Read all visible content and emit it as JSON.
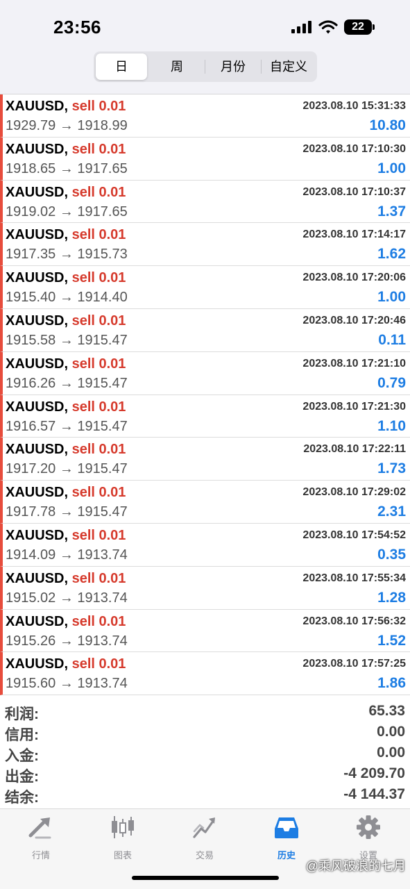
{
  "status_bar": {
    "time": "23:56",
    "battery": "22"
  },
  "segments": [
    {
      "label": "日",
      "active": true
    },
    {
      "label": "周",
      "active": false
    },
    {
      "label": "月份",
      "active": false
    },
    {
      "label": "自定义",
      "active": false
    }
  ],
  "trades": [
    {
      "symbol": "XAUUSD,",
      "side": "sell 0.01",
      "time": "2023.08.10 15:31:33",
      "prices": "1929.79 → 1918.99",
      "profit": "10.80"
    },
    {
      "symbol": "XAUUSD,",
      "side": "sell 0.01",
      "time": "2023.08.10 17:10:30",
      "prices": "1918.65 → 1917.65",
      "profit": "1.00"
    },
    {
      "symbol": "XAUUSD,",
      "side": "sell 0.01",
      "time": "2023.08.10 17:10:37",
      "prices": "1919.02 → 1917.65",
      "profit": "1.37"
    },
    {
      "symbol": "XAUUSD,",
      "side": "sell 0.01",
      "time": "2023.08.10 17:14:17",
      "prices": "1917.35 → 1915.73",
      "profit": "1.62"
    },
    {
      "symbol": "XAUUSD,",
      "side": "sell 0.01",
      "time": "2023.08.10 17:20:06",
      "prices": "1915.40 → 1914.40",
      "profit": "1.00"
    },
    {
      "symbol": "XAUUSD,",
      "side": "sell 0.01",
      "time": "2023.08.10 17:20:46",
      "prices": "1915.58 → 1915.47",
      "profit": "0.11"
    },
    {
      "symbol": "XAUUSD,",
      "side": "sell 0.01",
      "time": "2023.08.10 17:21:10",
      "prices": "1916.26 → 1915.47",
      "profit": "0.79"
    },
    {
      "symbol": "XAUUSD,",
      "side": "sell 0.01",
      "time": "2023.08.10 17:21:30",
      "prices": "1916.57 → 1915.47",
      "profit": "1.10"
    },
    {
      "symbol": "XAUUSD,",
      "side": "sell 0.01",
      "time": "2023.08.10 17:22:11",
      "prices": "1917.20 → 1915.47",
      "profit": "1.73"
    },
    {
      "symbol": "XAUUSD,",
      "side": "sell 0.01",
      "time": "2023.08.10 17:29:02",
      "prices": "1917.78 → 1915.47",
      "profit": "2.31"
    },
    {
      "symbol": "XAUUSD,",
      "side": "sell 0.01",
      "time": "2023.08.10 17:54:52",
      "prices": "1914.09 → 1913.74",
      "profit": "0.35"
    },
    {
      "symbol": "XAUUSD,",
      "side": "sell 0.01",
      "time": "2023.08.10 17:55:34",
      "prices": "1915.02 → 1913.74",
      "profit": "1.28"
    },
    {
      "symbol": "XAUUSD,",
      "side": "sell 0.01",
      "time": "2023.08.10 17:56:32",
      "prices": "1915.26 → 1913.74",
      "profit": "1.52"
    },
    {
      "symbol": "XAUUSD,",
      "side": "sell 0.01",
      "time": "2023.08.10 17:57:25",
      "prices": "1915.60 → 1913.74",
      "profit": "1.86"
    }
  ],
  "summary": [
    {
      "label": "利润:",
      "value": "65.33"
    },
    {
      "label": "信用:",
      "value": "0.00"
    },
    {
      "label": "入金:",
      "value": "0.00"
    },
    {
      "label": "出金:",
      "value": "-4 209.70"
    },
    {
      "label": "结余:",
      "value": "-4 144.37"
    }
  ],
  "tabs": [
    {
      "label": "行情",
      "icon": "quotes-arrows-icon",
      "active": false
    },
    {
      "label": "图表",
      "icon": "candlestick-chart-icon",
      "active": false
    },
    {
      "label": "交易",
      "icon": "trade-trend-icon",
      "active": false
    },
    {
      "label": "历史",
      "icon": "history-inbox-icon",
      "active": true
    },
    {
      "label": "设置",
      "icon": "gear-icon",
      "active": false
    }
  ],
  "watermark": "@乘风破浪的七月",
  "colors": {
    "accent": "#1d7de3",
    "sell": "#d63a2c",
    "row_marker": "#e74c3c",
    "inactive_tab": "#8e8e93"
  }
}
